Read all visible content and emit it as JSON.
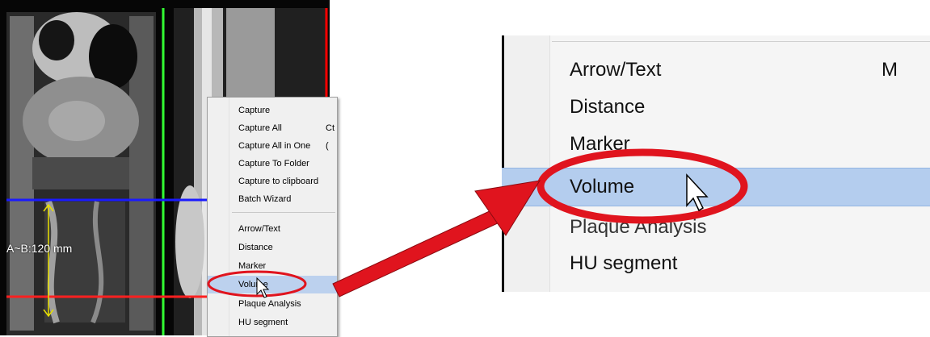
{
  "viewer": {
    "measurement_label": "A~B:120 mm",
    "crosshair_colors": {
      "horizontal_top": "#1a1aff",
      "horizontal_bottom": "#ff0000",
      "vertical": "#33ff33",
      "border_right": "#ff0000",
      "measure_line": "#e8e000"
    }
  },
  "context_menu": {
    "items": [
      {
        "label": "Capture",
        "shortcut": ""
      },
      {
        "label": "Capture All",
        "shortcut": "Ct"
      },
      {
        "label": "Capture All in One",
        "shortcut": "("
      },
      {
        "label": "Capture To Folder",
        "shortcut": ""
      },
      {
        "label": "Capture to clipboard",
        "shortcut": ""
      },
      {
        "label": "Batch Wizard",
        "shortcut": ""
      },
      {
        "label": "Arrow/Text",
        "shortcut": ""
      },
      {
        "label": "Distance",
        "shortcut": ""
      },
      {
        "label": "Marker",
        "shortcut": ""
      },
      {
        "label": "Volume",
        "shortcut": "",
        "selected": true
      },
      {
        "label": "Plaque Analysis",
        "shortcut": ""
      },
      {
        "label": "HU segment",
        "shortcut": ""
      }
    ]
  },
  "zoom_menu": {
    "items": [
      {
        "label": "Arrow/Text",
        "shortcut": "M"
      },
      {
        "label": "Distance",
        "shortcut": ""
      },
      {
        "label": "Marker",
        "shortcut": ""
      },
      {
        "label": "Volume",
        "shortcut": "",
        "selected": true
      },
      {
        "label": "Plaque Analysis",
        "shortcut": ""
      },
      {
        "label": "HU segment",
        "shortcut": ""
      }
    ]
  },
  "annotation": {
    "highlight_color": "#e0141e",
    "icons": [
      "mouse-pointer-icon"
    ]
  }
}
